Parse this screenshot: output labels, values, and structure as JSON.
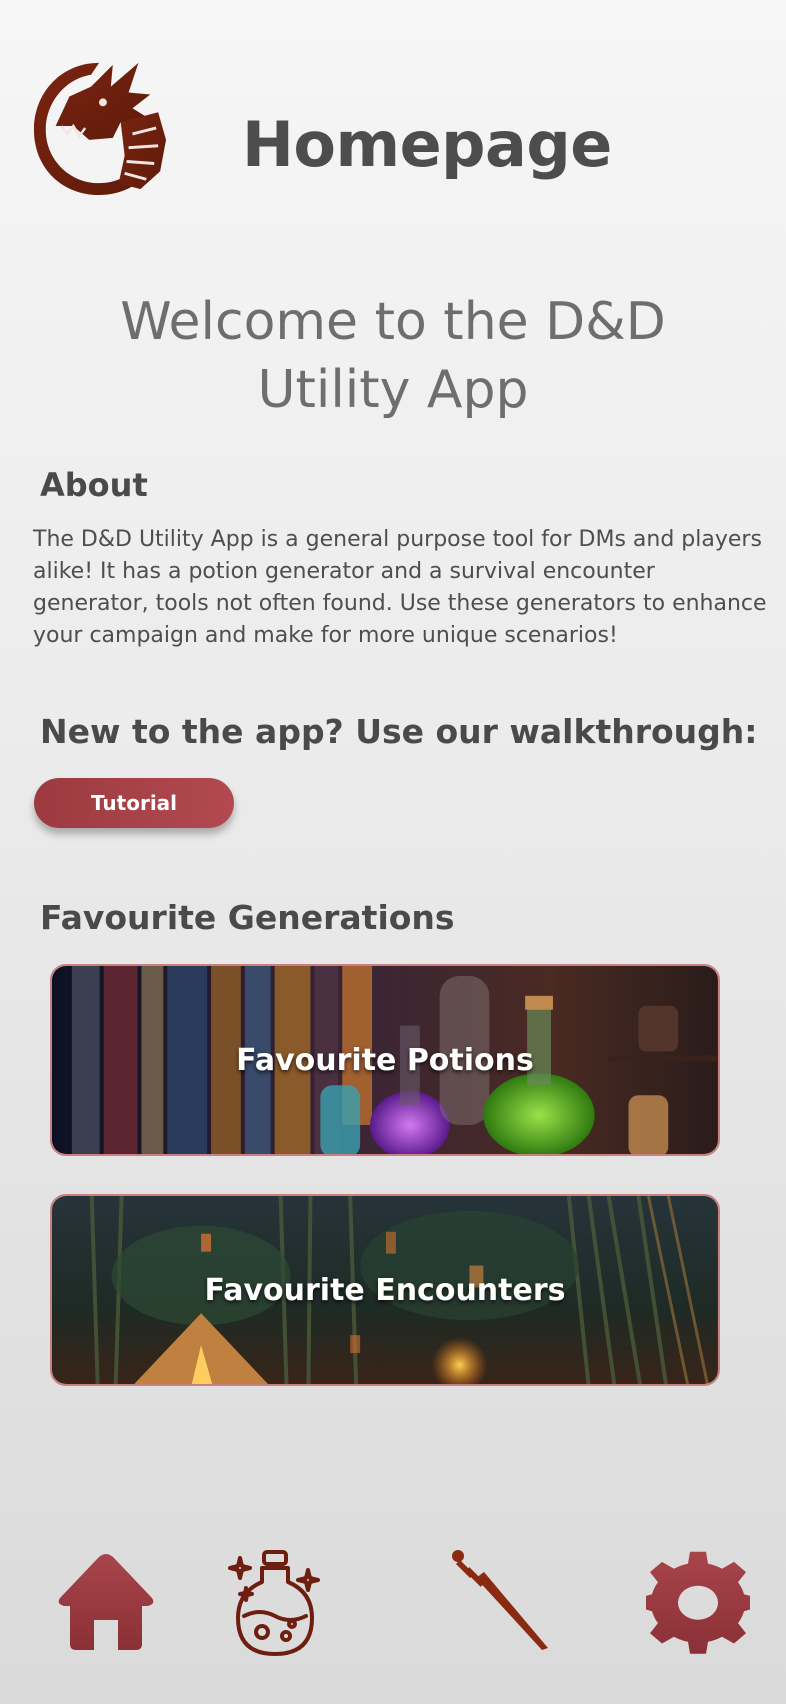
{
  "header": {
    "title": "Homepage",
    "logo_icon": "dragon-logo-icon"
  },
  "welcome": {
    "line1": "Welcome to the D&D",
    "line2": "Utility App"
  },
  "about": {
    "heading": "About",
    "text": "The D&D Utility App is a general purpose tool for DMs and players alike! It has a potion generator and a survival encounter generator, tools not often found. Use these generators to enhance your campaign and make for more unique scenarios!"
  },
  "walkthrough": {
    "heading": "New to the app? Use our walkthrough:",
    "button_label": "Tutorial"
  },
  "favourites": {
    "heading": "Favourite Generations",
    "potions_label": "Favourite Potions",
    "encounters_label": "Favourite Encounters"
  },
  "bottom_nav": {
    "items": [
      {
        "icon": "home-icon"
      },
      {
        "icon": "potion-icon"
      },
      {
        "icon": "dagger-icon"
      },
      {
        "icon": "gear-icon"
      }
    ]
  },
  "colors": {
    "accent": "#9b3a40",
    "dark_red": "#6e1e0e",
    "text": "#4a4a4a"
  }
}
